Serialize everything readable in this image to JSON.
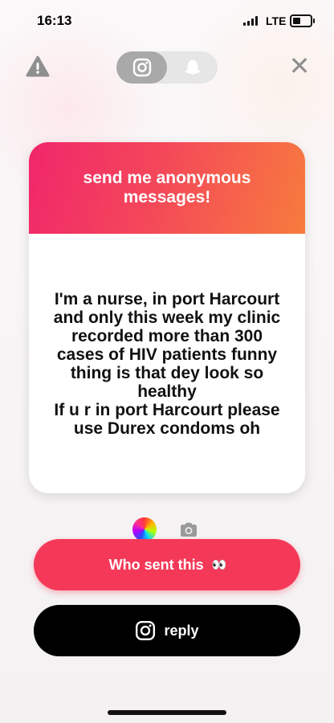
{
  "status_bar": {
    "time": "16:13",
    "network": "LTE"
  },
  "top_bar": {
    "warning_icon": "warning-triangle-icon",
    "tabs": [
      {
        "icon": "instagram-icon",
        "active": true
      },
      {
        "icon": "snapchat-ghost-icon",
        "active": false
      }
    ],
    "close_icon": "close-icon"
  },
  "card": {
    "header": "send me anonymous messages!",
    "message": "I'm a nurse, in port Harcourt and only this week my clinic recorded more than 300 cases of HIV patients funny thing is that dey look so healthy\nIf u r in port Harcourt please use Durex condoms oh"
  },
  "tools": {
    "color_icon": "color-wheel-icon",
    "camera_icon": "camera-icon"
  },
  "buttons": {
    "who_sent": "Who sent this",
    "who_sent_emoji": "👀",
    "reply": "reply"
  },
  "colors": {
    "accent": "#f43958",
    "gradient_start": "#f0266b",
    "gradient_end": "#f77b3d"
  }
}
